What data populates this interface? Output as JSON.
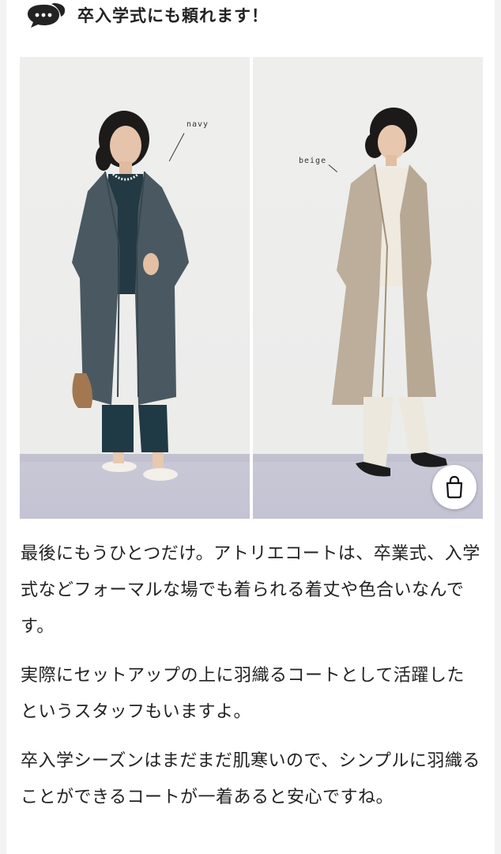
{
  "heading": {
    "icon": "speech-bubble-icon",
    "text": "卒入学式にも頼れます！"
  },
  "photo": {
    "left_label": "navy",
    "right_label": "beige",
    "bag_icon": "shopping-bag-icon"
  },
  "paragraphs": [
    "最後にもうひとつだけ。アトリエコートは、卒業式、入学式などフォーマルな場でも着られる着丈や色合いなんです。",
    "実際にセットアップの上に羽織るコートとして活躍したというスタッフもいますよ。",
    "卒入学シーズンはまだまだ肌寒いので、シンプルに羽織ることができるコートが一着あると安心ですね。"
  ],
  "colors": {
    "navy": "#3f4c54",
    "beige": "#b9aa97"
  }
}
